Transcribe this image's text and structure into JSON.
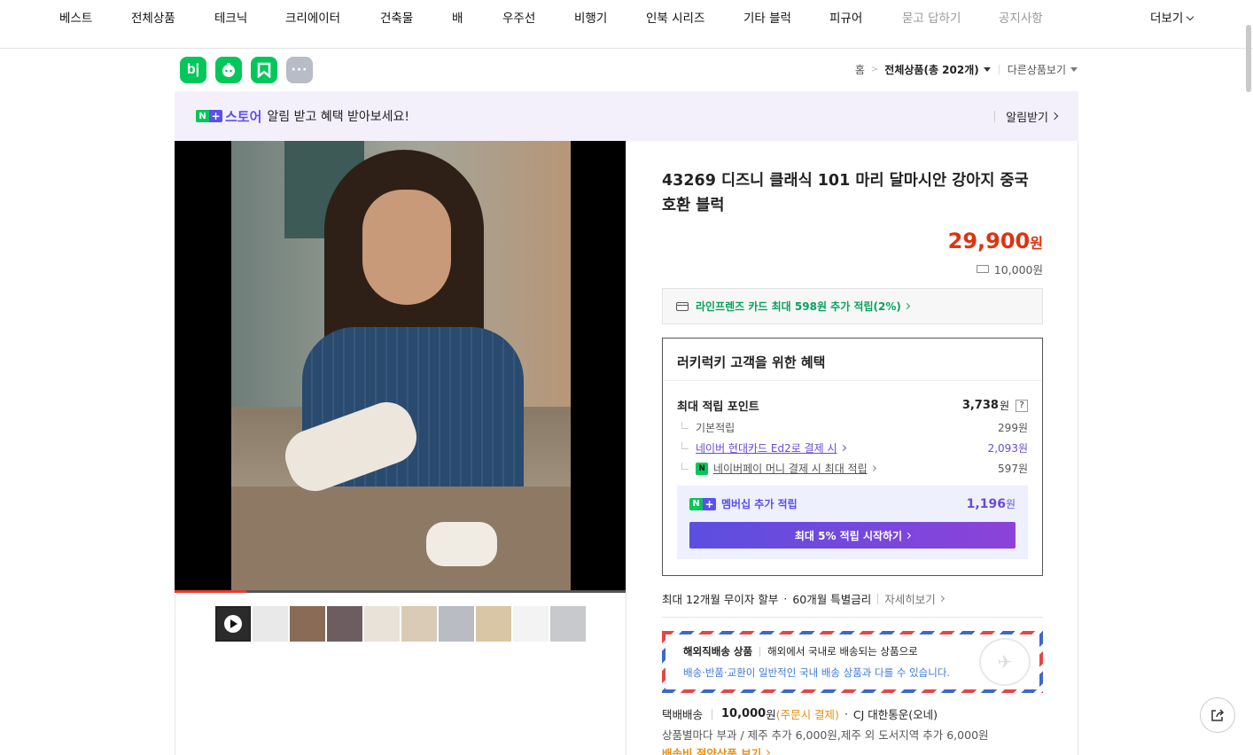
{
  "nav": {
    "items": [
      "베스트",
      "전체상품",
      "테크닉",
      "크리에이터",
      "건축물",
      "배",
      "우주선",
      "비행기",
      "인북 시리즈",
      "기타 블럭",
      "피규어",
      "묻고 답하기",
      "공지사항"
    ],
    "more_label": "더보기"
  },
  "app_icons": {
    "blog": "b|",
    "dots": "···"
  },
  "breadcrumb": {
    "home": "홈",
    "category": "전체상품",
    "count": "(총 202개)",
    "other": "다른상품보기"
  },
  "store_banner": {
    "n": "N",
    "plus": "+",
    "store": "스토어",
    "text": "알림 받고 혜택 받아보세요!",
    "cta": "알림받기"
  },
  "product": {
    "title": "43269 디즈니 클래식 101 마리 달마시안 강아지 중국 호환 블럭",
    "price": "29,900",
    "price_unit": "원",
    "shipping_fee": "10,000원",
    "video_progress": 0.16,
    "thumbnail_count": 10
  },
  "card_promo": "라인프렌즈 카드 최대 598원 추가 적립(2%)",
  "benefit": {
    "title": "러키럭키 고객을 위한 혜택",
    "max_points_label": "최대 적립 포인트",
    "max_points_value": "3,738",
    "max_points_unit": "원",
    "help": "?",
    "rows": [
      {
        "label": "기본적립",
        "value": "299원"
      },
      {
        "label": "네이버 현대카드 Ed2로 결제 시",
        "value": "2,093원"
      },
      {
        "label": "네이버페이 머니 결제 시 최대 적립",
        "value": "597원"
      }
    ],
    "npay_badge": "N",
    "membership_label": "멤버십 추가 적립",
    "membership_value": "1,196",
    "membership_unit": "원",
    "membership_cta": "최대 5% 적립 시작하기"
  },
  "installment": {
    "text": "최대 12개월 무이자 할부",
    "special": "60개월 특별금리",
    "more": "자세히보기"
  },
  "airmail": {
    "label": "해외직배송 상품",
    "desc": "해외에서 국내로 배송되는 상품으로",
    "note": "배송·반품·교환이 일반적인 국내 배송 상품과 다를 수 있습니다.",
    "stamp_icon": "✈"
  },
  "delivery": {
    "method": "택배배송",
    "amount": "10,000",
    "amount_unit": "원",
    "payment": "(주문시 결제)",
    "carrier": "CJ 대한통운(오네)",
    "fee_note": "상품별마다 부과 / 제주 추가 6,000원,제주 외 도서지역 추가 6,000원",
    "saving": "배송비 절약상품 보기"
  },
  "colors": {
    "accent_green": "#03c75a",
    "price_red": "#dd1111",
    "store_purple": "#5a4ff0",
    "orange": "#e8900c"
  }
}
